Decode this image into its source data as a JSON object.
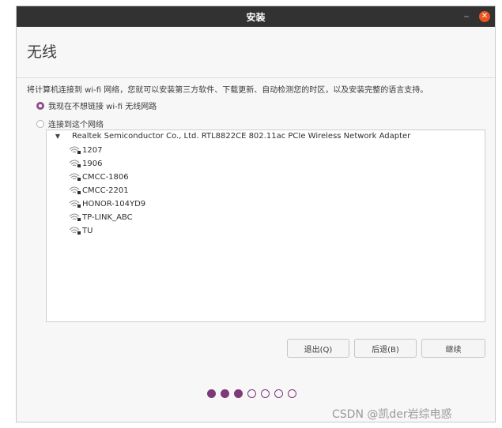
{
  "window": {
    "title": "安装",
    "minimize_glyph": "–",
    "close_glyph": "✕"
  },
  "page": {
    "title": "无线",
    "intro": "将计算机连接到 wi-fi 网络，您就可以安装第三方软件、下载更新、自动检测您的时区，以及安装完整的语言支持。"
  },
  "options": {
    "no_wifi": {
      "label": "我现在不想链接 wi-fi 无线网路",
      "checked": true
    },
    "connect": {
      "label": "连接到这个网络",
      "checked": false
    }
  },
  "adapter": {
    "expander_glyph": "▼",
    "name": "Realtek Semiconductor Co., Ltd. RTL8822CE 802.11ac PCIe Wireless Network Adapter"
  },
  "networks": [
    {
      "ssid": "1207",
      "icon": "wifi-locked-icon"
    },
    {
      "ssid": "1906",
      "icon": "wifi-locked-icon"
    },
    {
      "ssid": "CMCC-1806",
      "icon": "wifi-locked-icon"
    },
    {
      "ssid": "CMCC-2201",
      "icon": "wifi-locked-icon"
    },
    {
      "ssid": "HONOR-104YD9",
      "icon": "wifi-locked-icon"
    },
    {
      "ssid": "TP-LINK_ABC",
      "icon": "wifi-locked-icon"
    },
    {
      "ssid": "TU",
      "icon": "wifi-locked-icon"
    }
  ],
  "buttons": {
    "quit": "退出(Q)",
    "back": "后退(B)",
    "continue": "继续"
  },
  "progress": {
    "current_step": 3,
    "total_steps": 7
  },
  "colors": {
    "titlebar": "#323232",
    "close": "#e95420",
    "accent": "#924d8b",
    "progress_dot": "#7e3a78"
  },
  "watermark": "CSDN @凯der岩综电惑"
}
